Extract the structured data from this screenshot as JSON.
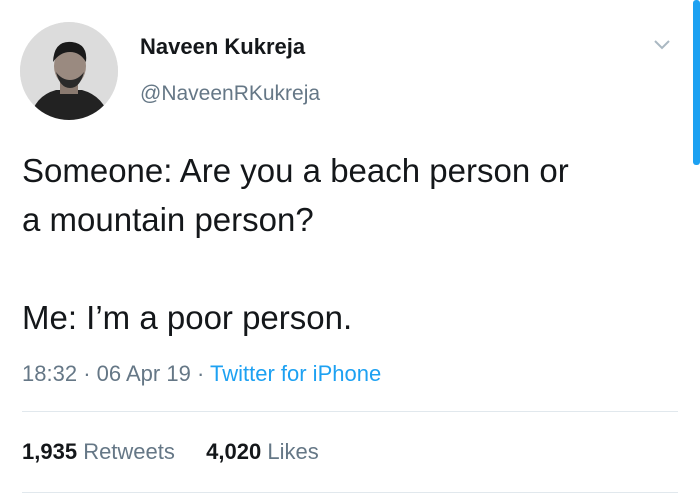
{
  "user": {
    "name": "Naveen Kukreja",
    "handle": "@NaveenRKukreja"
  },
  "tweet": {
    "text": "Someone: Are you a beach person or\na mountain person?\n\nMe: I’m a poor person.",
    "time": "18:32",
    "date": "06 Apr 19",
    "source": "Twitter for iPhone"
  },
  "stats": {
    "retweets_count": "1,935",
    "retweets_label": "Retweets",
    "likes_count": "4,020",
    "likes_label": "Likes"
  },
  "icons": {
    "menu": "chevron-down-icon"
  },
  "colors": {
    "accent": "#1da1f2",
    "secondary_text": "#657786",
    "primary_text": "#14171a"
  }
}
